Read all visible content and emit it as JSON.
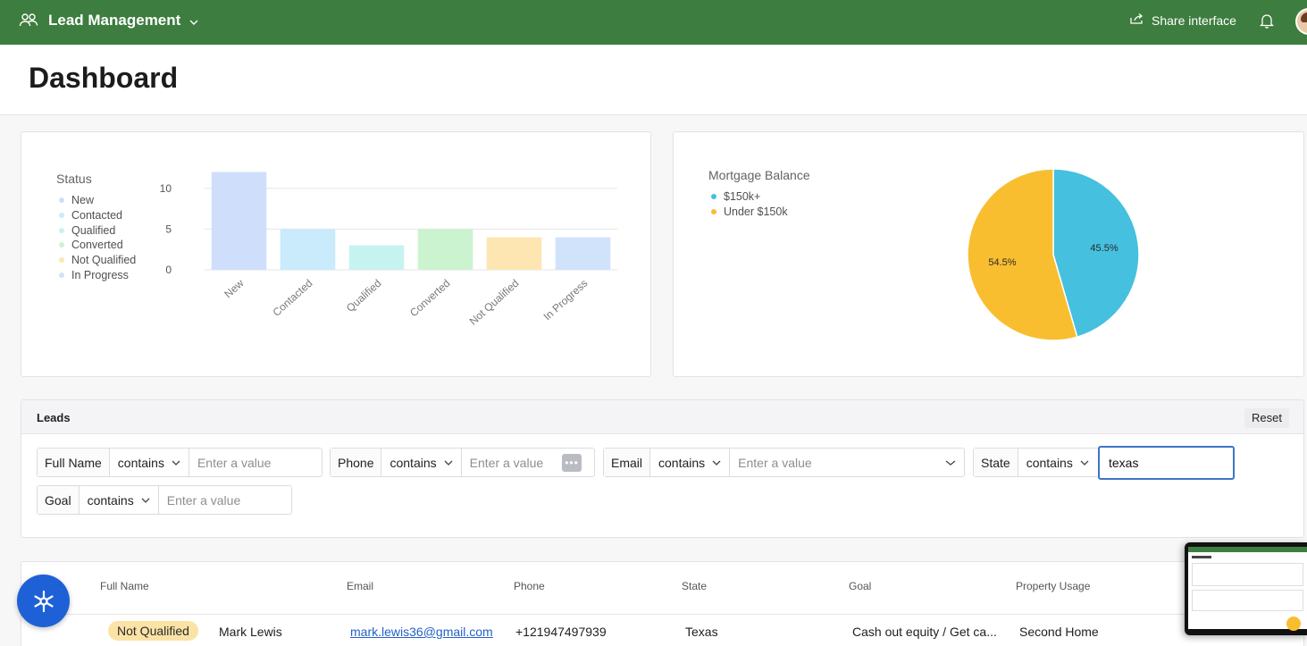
{
  "topbar": {
    "app_title": "Lead Management",
    "share_label": "Share interface",
    "icons": [
      "people-icon",
      "chevron-down-icon",
      "share-icon",
      "bell-icon",
      "avatar"
    ]
  },
  "page": {
    "title": "Dashboard"
  },
  "status_chart": {
    "legend_title": "Status",
    "chart_data": {
      "type": "bar",
      "categories": [
        "New",
        "Contacted",
        "Qualified",
        "Converted",
        "Not Qualified",
        "In Progress"
      ],
      "values": [
        12,
        5,
        3,
        5,
        4,
        4
      ],
      "colors": [
        "#cfdffb",
        "#c9ebfb",
        "#c6f3ef",
        "#ccf3cf",
        "#fde6b2",
        "#d1e2fb"
      ],
      "yticks": [
        0,
        5,
        10
      ],
      "ylim": [
        0,
        12.5
      ],
      "grid": true,
      "legend_placement": "left"
    }
  },
  "mortgage_chart": {
    "legend_title": "Mortgage Balance",
    "chart_data": {
      "type": "pie",
      "labels": [
        "$150k+",
        "Under $150k"
      ],
      "values": [
        45.5,
        54.5
      ],
      "value_labels": [
        "45.5%",
        "54.5%"
      ],
      "colors": [
        "#45c0de",
        "#f9be30"
      ],
      "legend_placement": "top-left"
    }
  },
  "leads": {
    "title": "Leads",
    "reset_label": "Reset",
    "filters": {
      "full_name": {
        "label": "Full Name",
        "op": "contains",
        "placeholder": "Enter a value",
        "value": ""
      },
      "phone": {
        "label": "Phone",
        "op": "contains",
        "placeholder": "Enter a value",
        "value": ""
      },
      "email": {
        "label": "Email",
        "op": "contains",
        "placeholder": "Enter a value",
        "value": ""
      },
      "state": {
        "label": "State",
        "op": "contains",
        "placeholder": "",
        "value": "texas"
      },
      "goal": {
        "label": "Goal",
        "op": "contains",
        "placeholder": "Enter a value",
        "value": ""
      }
    }
  },
  "table": {
    "columns": [
      "Full Name",
      "Email",
      "Phone",
      "State",
      "Goal",
      "Property Usage"
    ],
    "rows": [
      {
        "status": "Not Qualified",
        "full_name": "Mark Lewis",
        "email": "mark.lewis36@gmail.com",
        "phone": "+121947497939",
        "state": "Texas",
        "goal": "Cash out equity / Get ca...",
        "property_usage": "Second Home"
      }
    ]
  }
}
